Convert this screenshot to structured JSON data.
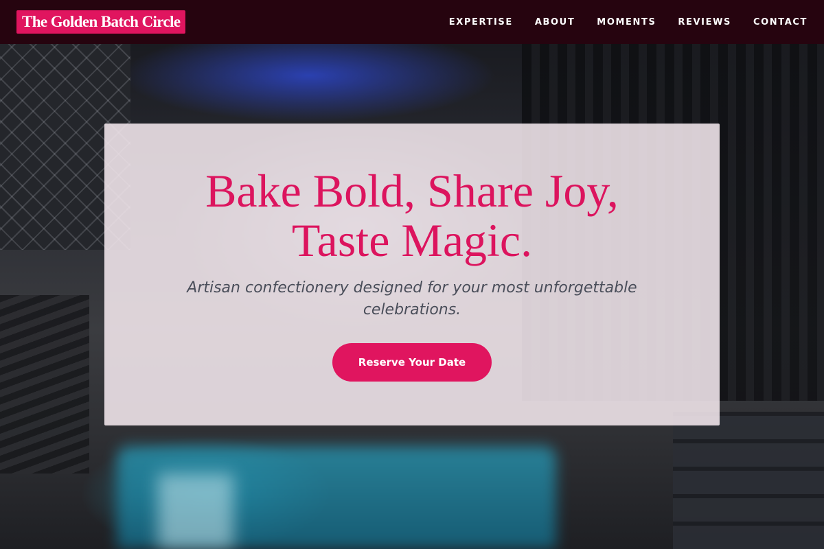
{
  "header": {
    "brand": "The Golden Batch Circle",
    "nav": [
      {
        "label": "EXPERTISE"
      },
      {
        "label": "ABOUT"
      },
      {
        "label": "MOMENTS"
      },
      {
        "label": "REVIEWS"
      },
      {
        "label": "CONTACT"
      }
    ]
  },
  "hero": {
    "title_line1": "Bake Bold, Share Joy,",
    "title_line2": "Taste Magic.",
    "subtitle_line1": "Artisan confectionery designed for your most unforgettable",
    "subtitle_line2": "celebrations.",
    "cta_label": "Reserve Your Date"
  },
  "colors": {
    "accent": "#e0155f",
    "header_bg": "#26040f",
    "card_bg": "#f4e8ee",
    "subtitle_text": "#4a4e5a"
  }
}
